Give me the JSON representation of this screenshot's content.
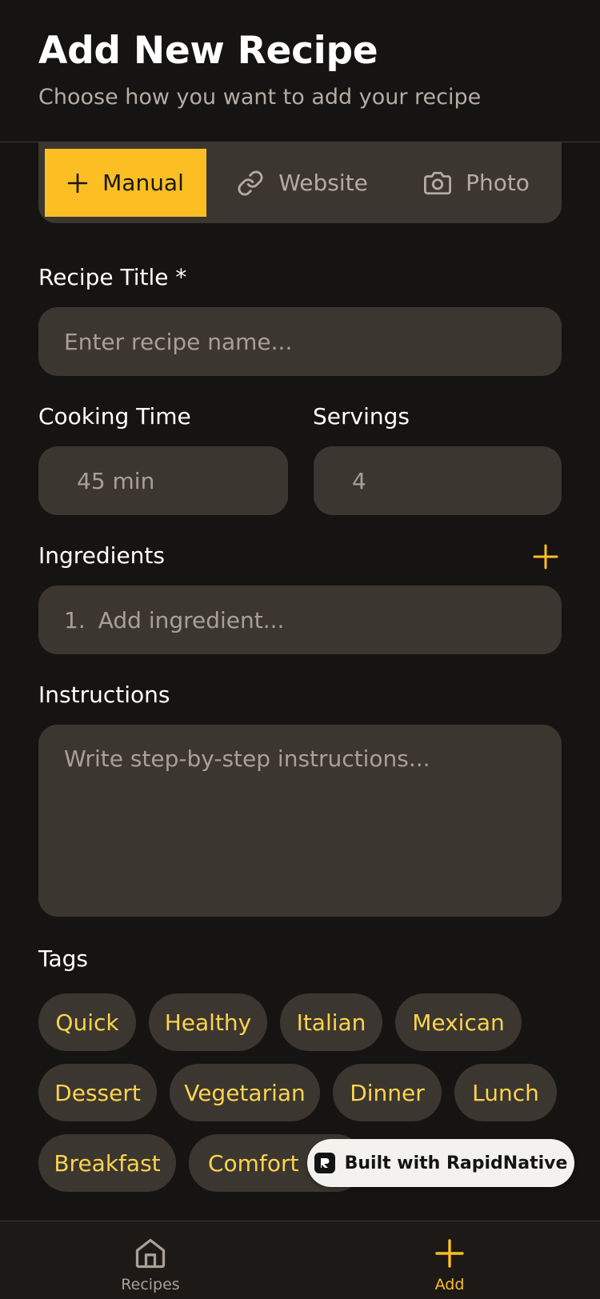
{
  "header": {
    "title": "Add New Recipe",
    "subtitle": "Choose how you want to add your recipe"
  },
  "method_tabs": [
    {
      "label": "Manual",
      "icon": "plus-icon",
      "selected": true
    },
    {
      "label": "Website",
      "icon": "link-icon",
      "selected": false
    },
    {
      "label": "Photo",
      "icon": "camera-icon",
      "selected": false
    }
  ],
  "form": {
    "title_label": "Recipe Title *",
    "title_placeholder": "Enter recipe name...",
    "cooking_time_label": "Cooking Time",
    "cooking_time_placeholder": "45 min",
    "servings_label": "Servings",
    "servings_placeholder": "4",
    "ingredients_label": "Ingredients",
    "ingredient_number": "1.",
    "ingredient_placeholder": "Add ingredient...",
    "instructions_label": "Instructions",
    "instructions_placeholder": "Write step-by-step instructions...",
    "tags_label": "Tags"
  },
  "tags": [
    "Quick",
    "Healthy",
    "Italian",
    "Mexican",
    "Dessert",
    "Vegetarian",
    "Dinner",
    "Lunch",
    "Breakfast",
    "Comfort F"
  ],
  "badge": {
    "label": "Built with RapidNative"
  },
  "tabbar": {
    "recipes_label": "Recipes",
    "add_label": "Add"
  },
  "colors": {
    "accent": "#fbbf24",
    "background": "#161412",
    "surface": "#3c3630",
    "tag_text": "#fcd34d",
    "muted_text": "#a8a098"
  }
}
